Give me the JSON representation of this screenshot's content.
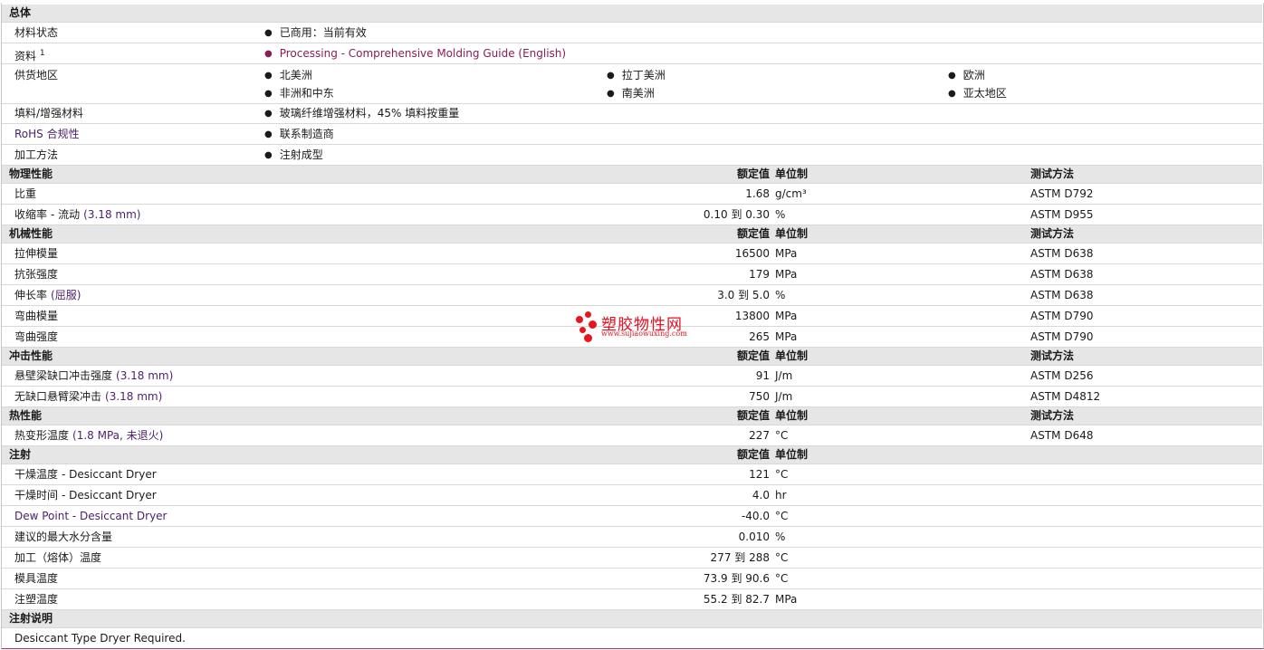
{
  "general": {
    "title": "总体",
    "material_status_label": "材料状态",
    "material_status": "已商用：当前有效",
    "docs_label": "资料",
    "docs_sup": "1",
    "docs_link": "Processing - Comprehensive Molding Guide (English)",
    "supply_label": "供货地区",
    "regions": [
      "北美洲",
      "拉丁美洲",
      "欧洲",
      "非洲和中东",
      "南美洲",
      "亚太地区"
    ],
    "filler_label": "填料/增强材料",
    "filler": "玻璃纤维增强材料，45% 填料按重量",
    "rohs_label": "RoHS 合规性",
    "rohs": "联系制造商",
    "process_label": "加工方法",
    "process": "注射成型"
  },
  "headers": {
    "nominal": "额定值",
    "unit": "单位制",
    "test": "测试方法"
  },
  "physical": {
    "title": "物理性能",
    "rows": [
      {
        "label": "比重",
        "sub": "",
        "cond": "",
        "value": "1.68",
        "unit": "g/cm³",
        "test": "ASTM D792"
      },
      {
        "label": "收缩率",
        "sub": "- 流动",
        "cond": "(3.18 mm)",
        "value": "0.10 到  0.30",
        "unit": "%",
        "test": "ASTM D955"
      }
    ]
  },
  "mechanical": {
    "title": "机械性能",
    "rows": [
      {
        "label": "拉伸模量",
        "cond": "",
        "value": "16500",
        "unit": "MPa",
        "test": "ASTM D638"
      },
      {
        "label": "抗张强度",
        "cond": "",
        "value": "179",
        "unit": "MPa",
        "test": "ASTM D638"
      },
      {
        "label": "伸长率",
        "cond": "(屈服)",
        "value": "3.0 到  5.0",
        "unit": "%",
        "test": "ASTM D638"
      },
      {
        "label": "弯曲模量",
        "cond": "",
        "value": "13800",
        "unit": "MPa",
        "test": "ASTM D790"
      },
      {
        "label": "弯曲强度",
        "cond": "",
        "value": "265",
        "unit": "MPa",
        "test": "ASTM D790"
      }
    ]
  },
  "impact": {
    "title": "冲击性能",
    "rows": [
      {
        "label": "悬壁梁缺口冲击强度",
        "cond": "(3.18 mm)",
        "value": "91",
        "unit": "J/m",
        "test": "ASTM D256"
      },
      {
        "label": "无缺口悬臂梁冲击",
        "cond": "(3.18 mm)",
        "value": "750",
        "unit": "J/m",
        "test": "ASTM D4812"
      }
    ]
  },
  "thermal": {
    "title": "热性能",
    "rows": [
      {
        "label": "热变形温度",
        "cond": "(1.8 MPa, 未退火)",
        "value": "227",
        "unit": "°C",
        "test": "ASTM D648"
      }
    ]
  },
  "injection": {
    "title": "注射",
    "rows": [
      {
        "label": "干燥温度",
        "sub": "- Desiccant Dryer",
        "value": "121",
        "unit": "°C"
      },
      {
        "label": "干燥时间",
        "sub": "- Desiccant Dryer",
        "value": "4.0",
        "unit": "hr"
      },
      {
        "label": "Dew Point - Desiccant Dryer",
        "sub": "",
        "value": "-40.0",
        "unit": "°C",
        "purple": true
      },
      {
        "label": "建议的最大水分含量",
        "sub": "",
        "value": "0.010",
        "unit": "%"
      },
      {
        "label": "加工（熔体）温度",
        "sub": "",
        "value": "277 到  288",
        "unit": "°C"
      },
      {
        "label": "模具温度",
        "sub": "",
        "value": "73.9 到  90.6",
        "unit": "°C"
      },
      {
        "label": "注塑温度",
        "sub": "",
        "value": "55.2 到  82.7",
        "unit": "MPa"
      }
    ]
  },
  "notes": {
    "title": "注射说明",
    "text": "Desiccant Type Dryer Required."
  },
  "watermark": {
    "name": "塑胶物性网",
    "url": "www.sujiaowuxing.com",
    "color": "#e01020"
  }
}
